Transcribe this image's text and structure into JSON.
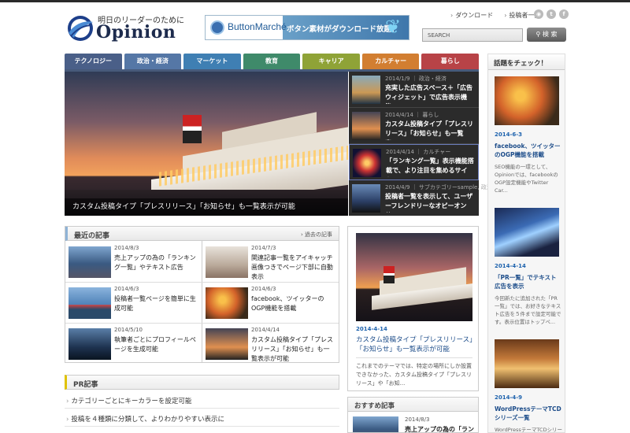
{
  "header": {
    "tagline": "明日のリーダーのために",
    "site_name": "Opinion",
    "banner": {
      "brand": "ButtonMarché",
      "copy": "ボタン素材がダウンロード放題！"
    },
    "links": [
      "ダウンロード",
      "投稿者一覧"
    ],
    "search_placeholder": "SEARCH",
    "search_button": "検 索"
  },
  "nav": [
    {
      "label": "テクノロジー",
      "color": "#4a5f88"
    },
    {
      "label": "政治・経済",
      "color": "#5577a6"
    },
    {
      "label": "マーケット",
      "color": "#3f7fb3"
    },
    {
      "label": "教育",
      "color": "#3f8a6a"
    },
    {
      "label": "キャリア",
      "color": "#8fa337"
    },
    {
      "label": "カルチャー",
      "color": "#d27e31"
    },
    {
      "label": "暮らし",
      "color": "#b84347"
    }
  ],
  "hero": {
    "caption": "カスタム投稿タイプ「プレスリリース」「お知らせ」も一覧表示が可能",
    "items": [
      {
        "meta": "2014/1/9 ｜ 政治・経済",
        "title": "充実した広告スペース＋「広告ウィジェット」で広告表示機能..."
      },
      {
        "meta": "2014/4/14 ｜ 暮らし",
        "title": "カスタム投稿タイプ「プレスリリース」「お知らせ」も一覧表..."
      },
      {
        "meta": "2014/4/14 ｜ カルチャー",
        "title": "「ランキング一覧」表示機能搭載で、より注目を集めるサイト..."
      },
      {
        "meta": "2014/4/9 ｜ サブカテゴリーsample, 政治・経済",
        "title": "投稿者一覧を表示して、ユーザーフレンドリーなオピーオンサ..."
      }
    ]
  },
  "recent": {
    "heading": "最近の記事",
    "more": "過去の記事",
    "items": [
      {
        "date": "2014/8/3",
        "title": "売上アップの為の「ランキング一覧」やテキスト広告"
      },
      {
        "date": "2014/7/3",
        "title": "関連記事一覧をアイキャッチ画像つきでページ下部に自動表示"
      },
      {
        "date": "2014/6/3",
        "title": "投稿者一覧ページを簡単に生成可能"
      },
      {
        "date": "2014/6/3",
        "title": "facebook、ツイッターのOGP機能を搭載"
      },
      {
        "date": "2014/5/10",
        "title": "執筆者ごとにプロフィールページを生成可能"
      },
      {
        "date": "2014/4/14",
        "title": "カスタム投稿タイプ「プレスリリース」「お知らせ」も一覧表示が可能"
      }
    ]
  },
  "pr": {
    "heading": "PR記事",
    "items": [
      "カテゴリーごとにキーカラーを設定可能",
      "投稿を４種類に分類して、よりわかりやすい表示に"
    ]
  },
  "featured": {
    "date": "2014-4-14",
    "title": "カスタム投稿タイプ「プレスリリース」「お知らせ」も一覧表示が可能",
    "desc": "これまでのテーマでは、特定の場所にしか設置できなかった、カスタム投稿タイプ「プレスリリース」や「お知..."
  },
  "osusume": {
    "heading": "おすすめ記事",
    "date": "2014/8/3",
    "title": "売上アップの為の「ランキ"
  },
  "sidebar": {
    "heading": "話題をチェック！",
    "items": [
      {
        "date": "2014-6-3",
        "title": "facebook、ツイッターのOGP機能を搭載",
        "desc": "SEO機能の一環として、Opinionでは、facebookのOGP設定機能やTwitter Car..."
      },
      {
        "date": "2014-4-14",
        "title": "「PR一覧」でテキスト広告を表示",
        "desc": "今回新たに追加された「PR一覧」では、お好きなテキスト広告を５件まで設定可能です。表示位置はトップペ..."
      },
      {
        "date": "2014-4-9",
        "title": "WordPressテーマTCDシリーズ一覧",
        "desc": "WordPressテーマTCDシリー"
      }
    ]
  }
}
